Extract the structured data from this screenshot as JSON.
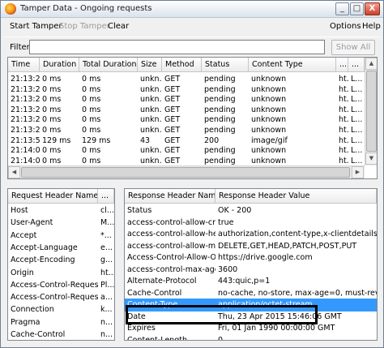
{
  "window": {
    "title": "Tamper Data - Ongoing requests",
    "icon": "firefox-icon",
    "buttons": {
      "minimize": "_",
      "maximize": "□",
      "close": "X"
    }
  },
  "menu": {
    "start_tamper": "Start Tamper",
    "stop_tamper": "Stop Tamper",
    "clear": "Clear",
    "options": "Options",
    "help": "Help"
  },
  "filter": {
    "label": "Filter",
    "value": "",
    "show_all": "Show All"
  },
  "requests": {
    "columns": [
      "Time",
      "Duration",
      "Total Duration",
      "Size",
      "Method",
      "Status",
      "Content Type",
      "...",
      "..."
    ],
    "rows": [
      [
        "21:13:2...",
        "0 ms",
        "0 ms",
        "unkn...",
        "GET",
        "pending",
        "unknown",
        "ht...",
        "L..."
      ],
      [
        "21:13:2...",
        "0 ms",
        "0 ms",
        "unkn...",
        "GET",
        "pending",
        "unknown",
        "ht...",
        "L..."
      ],
      [
        "21:13:2...",
        "0 ms",
        "0 ms",
        "unkn...",
        "GET",
        "pending",
        "unknown",
        "ht...",
        "L..."
      ],
      [
        "21:13:2...",
        "0 ms",
        "0 ms",
        "unkn...",
        "GET",
        "pending",
        "unknown",
        "ht...",
        "L..."
      ],
      [
        "21:13:2...",
        "0 ms",
        "0 ms",
        "unkn...",
        "GET",
        "pending",
        "unknown",
        "ht...",
        "L..."
      ],
      [
        "21:13:2...",
        "0 ms",
        "0 ms",
        "unkn...",
        "GET",
        "pending",
        "unknown",
        "ht...",
        "L..."
      ],
      [
        "21:13:5...",
        "129 ms",
        "129 ms",
        "43",
        "GET",
        "200",
        "image/gif",
        "ht...",
        "L..."
      ],
      [
        "21:14:0...",
        "0 ms",
        "0 ms",
        "unkn...",
        "GET",
        "pending",
        "unknown",
        "ht...",
        "L..."
      ],
      [
        "21:14:0...",
        "0 ms",
        "0 ms",
        "unkn...",
        "GET",
        "pending",
        "unknown",
        "ht...",
        "L..."
      ]
    ]
  },
  "request_headers": {
    "columns": [
      "Request Header Name",
      "..."
    ],
    "rows": [
      [
        "Host",
        "cl..."
      ],
      [
        "User-Agent",
        "M..."
      ],
      [
        "Accept",
        "*..."
      ],
      [
        "Accept-Language",
        "e..."
      ],
      [
        "Accept-Encoding",
        "g..."
      ],
      [
        "Origin",
        "ht..."
      ],
      [
        "Access-Control-Request-...",
        "Pl..."
      ],
      [
        "Access-Control-Request-...",
        "a..."
      ],
      [
        "Connection",
        "k..."
      ],
      [
        "Pragma",
        "n..."
      ],
      [
        "Cache-Control",
        "n..."
      ]
    ]
  },
  "response_headers": {
    "columns": [
      "Response Header Name",
      "Response Header Value"
    ],
    "selected_index": 8,
    "rows": [
      [
        "Status",
        "OK - 200"
      ],
      [
        "access-control-allow-cre...",
        "true"
      ],
      [
        "access-control-allow-hea...",
        "authorization,content-type,x-clientdetails,x-..."
      ],
      [
        "access-control-allow-met...",
        "DELETE,GET,HEAD,PATCH,POST,PUT"
      ],
      [
        "Access-Control-Allow-Ori...",
        "https://drive.google.com"
      ],
      [
        "access-control-max-age",
        "3600"
      ],
      [
        "Alternate-Protocol",
        "443:quic,p=1"
      ],
      [
        "Cache-Control",
        "no-cache, no-store, max-age=0, must-revali..."
      ],
      [
        "Content-Type",
        "application/octet-stream"
      ],
      [
        "Date",
        "Thu, 23 Apr 2015 15:46:06 GMT"
      ],
      [
        "Expires",
        "Fri, 01 Jan 1990 00:00:00 GMT"
      ],
      [
        "Content-Length",
        "0"
      ]
    ]
  },
  "colors": {
    "selection": "#3399ff",
    "annotation_frame": "#000000"
  }
}
